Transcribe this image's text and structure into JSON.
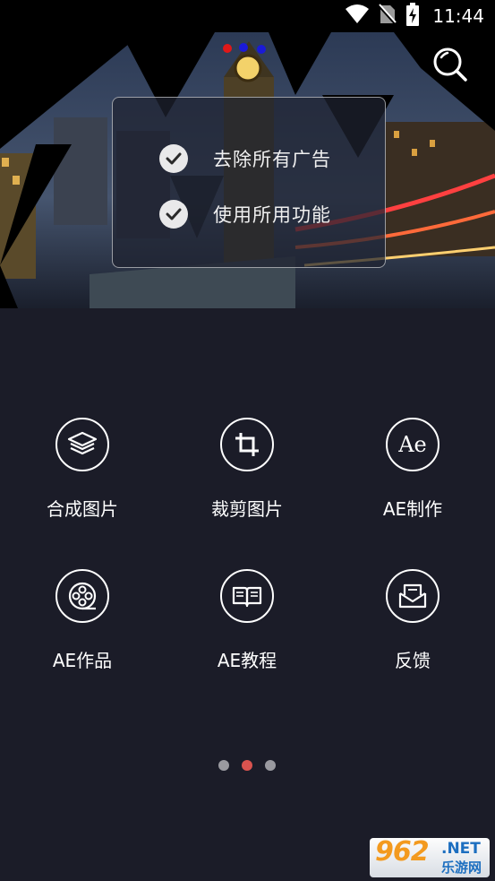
{
  "status_bar": {
    "time": "11:44"
  },
  "banner": {
    "promo_items": [
      "去除所有广告",
      "使用所用功能"
    ]
  },
  "features": [
    {
      "label": "合成图片",
      "icon": "layers-icon"
    },
    {
      "label": "裁剪图片",
      "icon": "crop-icon"
    },
    {
      "label": "AE制作",
      "icon": "ae-icon",
      "icon_text": "Ae"
    },
    {
      "label": "AE作品",
      "icon": "film-reel-icon"
    },
    {
      "label": "AE教程",
      "icon": "book-icon"
    },
    {
      "label": "反馈",
      "icon": "mail-icon"
    }
  ],
  "pager": {
    "count": 3,
    "active_index": 1
  },
  "watermark": {
    "number": "962",
    "net": ".NET",
    "sub": "乐游网"
  },
  "colors": {
    "background": "#1b1c28",
    "active_dot": "#d9534f",
    "inactive_dot": "#9a9aa0"
  }
}
